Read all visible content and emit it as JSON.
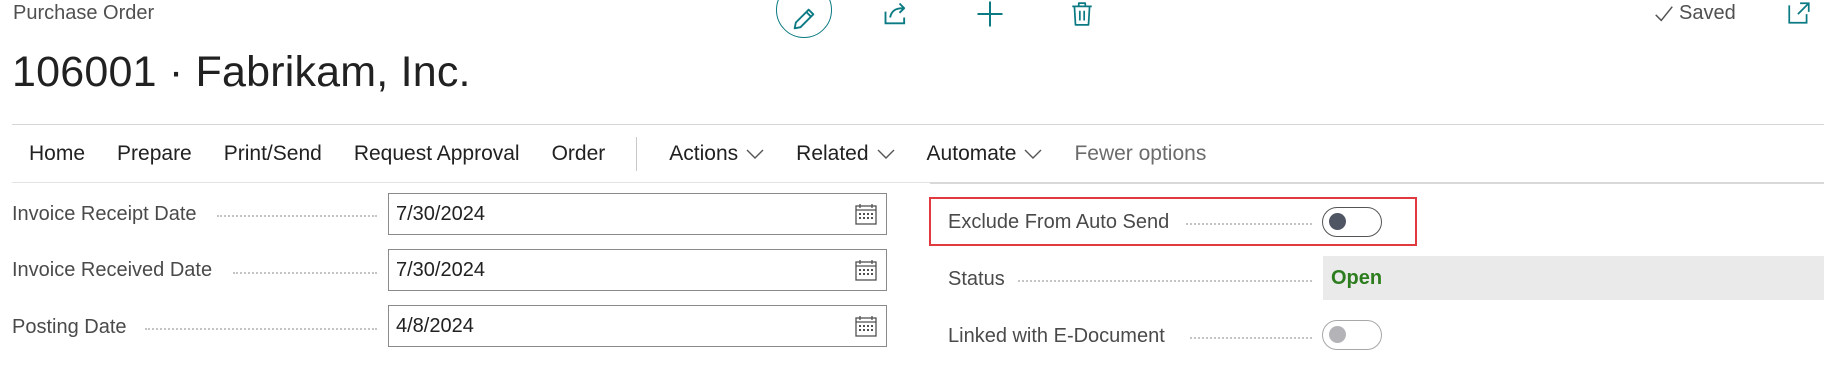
{
  "header": {
    "caption": "Purchase Order",
    "title": "106001 · Fabrikam, Inc.",
    "saved_label": "Saved"
  },
  "toolbar": {
    "icons": [
      "pencil-icon",
      "share-icon",
      "plus-icon",
      "trash-icon",
      "popout-icon",
      "checkmark-icon"
    ]
  },
  "nav": {
    "items": [
      "Home",
      "Prepare",
      "Print/Send",
      "Request Approval",
      "Order"
    ],
    "dropdowns": [
      "Actions",
      "Related",
      "Automate"
    ],
    "fewer_options": "Fewer options"
  },
  "fields_left": [
    {
      "label": "Invoice Receipt Date",
      "value": "7/30/2024"
    },
    {
      "label": "Invoice Received Date",
      "value": "7/30/2024"
    },
    {
      "label": "Posting Date",
      "value": "4/8/2024"
    }
  ],
  "fields_right": {
    "exclude_auto_send": {
      "label": "Exclude From Auto Send",
      "value": false
    },
    "status": {
      "label": "Status",
      "value": "Open"
    },
    "linked_edocument": {
      "label": "Linked with E-Document",
      "value": false
    }
  },
  "colors": {
    "accent": "#0b7a83",
    "status_open": "#2d7d1f",
    "highlight": "#e0393e"
  }
}
